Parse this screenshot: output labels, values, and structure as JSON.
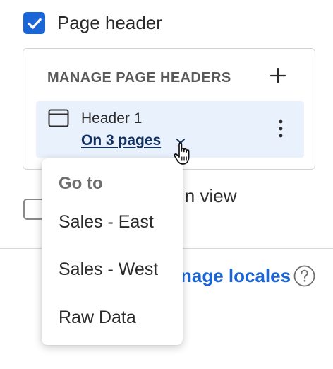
{
  "page_header": {
    "label": "Page header",
    "checked": true
  },
  "manage": {
    "title": "MANAGE PAGE HEADERS",
    "header_item": {
      "name": "Header 1",
      "pages_link": "On 3 pages"
    }
  },
  "second_option": {
    "label_visible": "in view",
    "checked": false
  },
  "locales": {
    "link_visible": "nage locales"
  },
  "menu": {
    "header": "Go to",
    "items": [
      {
        "label": "Sales - East"
      },
      {
        "label": "Sales - West"
      },
      {
        "label": "Raw Data"
      }
    ]
  },
  "colors": {
    "accent": "#1a66d6",
    "link_dark": "#12305f",
    "row_bg": "#e9f1fd"
  },
  "icons": [
    "check-icon",
    "plus-icon",
    "window-icon",
    "chevron-down-icon",
    "kebab-icon",
    "help-icon",
    "hand-cursor-icon"
  ]
}
